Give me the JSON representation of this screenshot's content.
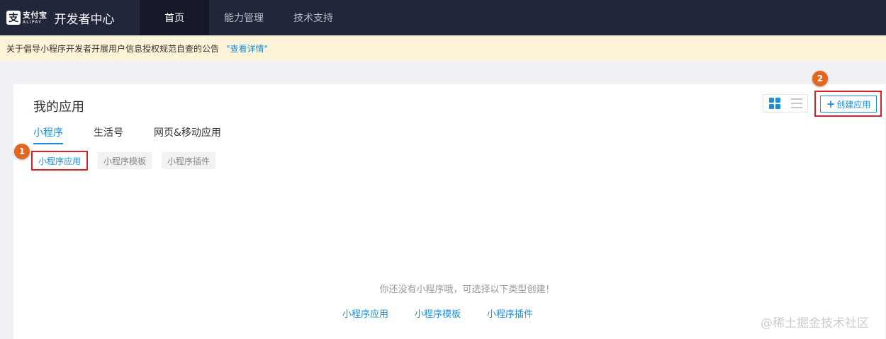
{
  "header": {
    "logo_cn": "支付宝",
    "logo_en": "ALIPAY",
    "title": "开发者中心",
    "nav": [
      {
        "label": "首页",
        "active": true
      },
      {
        "label": "能力管理",
        "active": false
      },
      {
        "label": "技术支持",
        "active": false
      }
    ]
  },
  "notice": {
    "text": "关于倡导小程序开发者开展用户信息授权规范自查的公告",
    "link": "\"查看详情\""
  },
  "main": {
    "title": "我的应用",
    "create_button": "创建应用",
    "tabs": [
      {
        "label": "小程序",
        "active": true
      },
      {
        "label": "生活号",
        "active": false
      },
      {
        "label": "网页&移动应用",
        "active": false
      }
    ],
    "subtypes": [
      {
        "label": "小程序应用",
        "active": true
      },
      {
        "label": "小程序模板",
        "active": false
      },
      {
        "label": "小程序插件",
        "active": false
      }
    ],
    "empty_message": "你还没有小程序哦，可选择以下类型创建！",
    "empty_links": [
      "小程序应用",
      "小程序模板",
      "小程序插件"
    ]
  },
  "annotations": {
    "badge_1": "1",
    "badge_2": "2"
  },
  "watermark": "@稀土掘金技术社区",
  "colors": {
    "accent": "#1c8fd8",
    "topbar": "#22263a",
    "notice_bg": "#fdf3d9",
    "highlight": "#d9212a",
    "badge": "#e2661e"
  }
}
